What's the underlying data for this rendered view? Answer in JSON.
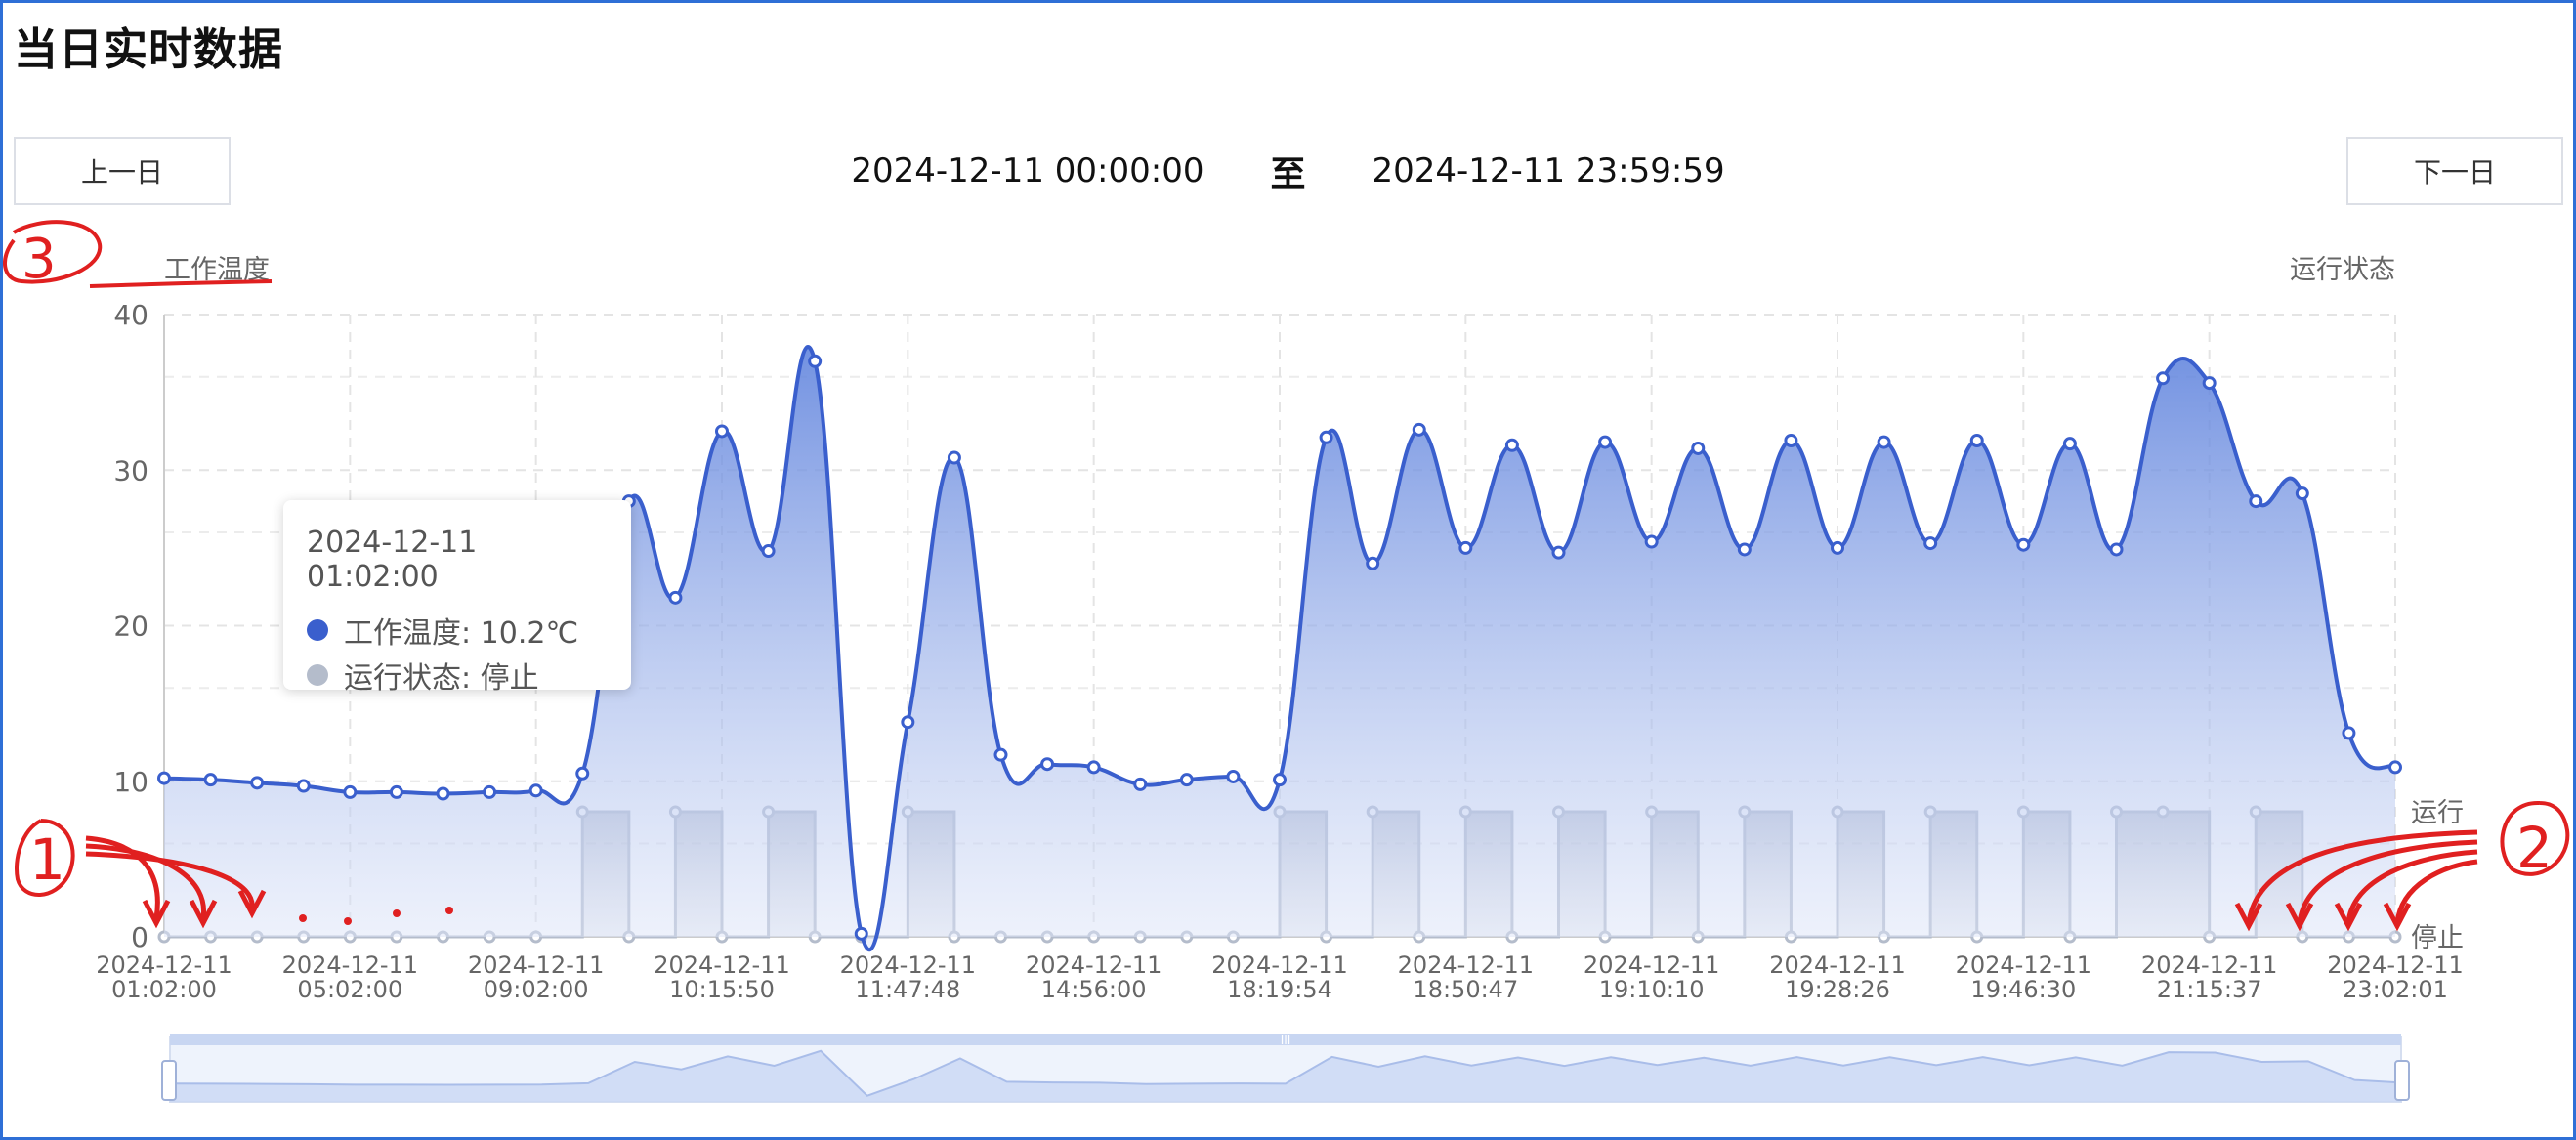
{
  "page": {
    "title": "当日实时数据"
  },
  "nav": {
    "prev_label": "上一日",
    "next_label": "下一日"
  },
  "range": {
    "start": "2024-12-11 00:00:00",
    "separator": "至",
    "end": "2024-12-11 23:59:59"
  },
  "colors": {
    "temp_line": "#3a5fcd",
    "temp_fill": "#6b8fe0",
    "status_line": "#b4bccb",
    "status_fill": "#aab2c4",
    "grid": "#e4e4e4",
    "axis_text": "#666666",
    "annotation": "#e02020",
    "frame": "#2f6fd6"
  },
  "tooltip": {
    "time": "2024-12-11 01:02:00",
    "rows": [
      {
        "label": "工作温度: 10.2℃",
        "color": "#3a5fcd"
      },
      {
        "label": "运行状态: 停止",
        "color": "#b4bccb"
      }
    ]
  },
  "annotations": {
    "circle_1": "1",
    "circle_2": "2",
    "circle_3": "3"
  },
  "chart_data": {
    "type": "line",
    "title": "",
    "xlabel": "",
    "ylabel": "工作温度",
    "ylabel_right": "运行状态",
    "ylim": [
      0,
      40
    ],
    "yticks": [
      0,
      10,
      20,
      30,
      40
    ],
    "right_ticks": [
      "停止",
      "运行"
    ],
    "grid": true,
    "x_tick_labels": [
      [
        "2024-12-11",
        "01:02:00"
      ],
      [
        "2024-12-11",
        "05:02:00"
      ],
      [
        "2024-12-11",
        "09:02:00"
      ],
      [
        "2024-12-11",
        "10:15:50"
      ],
      [
        "2024-12-11",
        "11:47:48"
      ],
      [
        "2024-12-11",
        "14:56:00"
      ],
      [
        "2024-12-11",
        "18:19:54"
      ],
      [
        "2024-12-11",
        "18:50:47"
      ],
      [
        "2024-12-11",
        "19:10:10"
      ],
      [
        "2024-12-11",
        "19:28:26"
      ],
      [
        "2024-12-11",
        "19:46:30"
      ],
      [
        "2024-12-11",
        "21:15:37"
      ],
      [
        "2024-12-11",
        "23:02:01"
      ]
    ],
    "x_tick_every": 4,
    "series": [
      {
        "name": "工作温度",
        "unit": "℃",
        "values": [
          10.2,
          10.1,
          9.9,
          9.7,
          9.3,
          9.3,
          9.2,
          9.3,
          9.4,
          10.5,
          28.0,
          21.8,
          32.5,
          24.8,
          37.0,
          0.2,
          13.8,
          30.8,
          11.7,
          11.1,
          10.9,
          9.8,
          10.1,
          10.3,
          10.1,
          32.1,
          24.0,
          32.6,
          25.0,
          31.6,
          24.7,
          31.8,
          25.4,
          31.4,
          24.9,
          31.9,
          25.0,
          31.8,
          25.3,
          31.9,
          25.2,
          31.7,
          24.9,
          35.9,
          35.6,
          28.0,
          28.5,
          13.1,
          10.9
        ]
      },
      {
        "name": "运行状态",
        "values": [
          0,
          0,
          0,
          0,
          0,
          0,
          0,
          0,
          0,
          1,
          0,
          1,
          0,
          1,
          0,
          0,
          1,
          0,
          0,
          0,
          0,
          0,
          0,
          0,
          1,
          0,
          1,
          0,
          1,
          0,
          1,
          0,
          1,
          0,
          1,
          0,
          1,
          0,
          1,
          0,
          1,
          0,
          1,
          1,
          0,
          1,
          0,
          0,
          0
        ]
      }
    ],
    "data_zoom": {
      "start": 0,
      "end": 100,
      "handle_label": "III"
    }
  }
}
